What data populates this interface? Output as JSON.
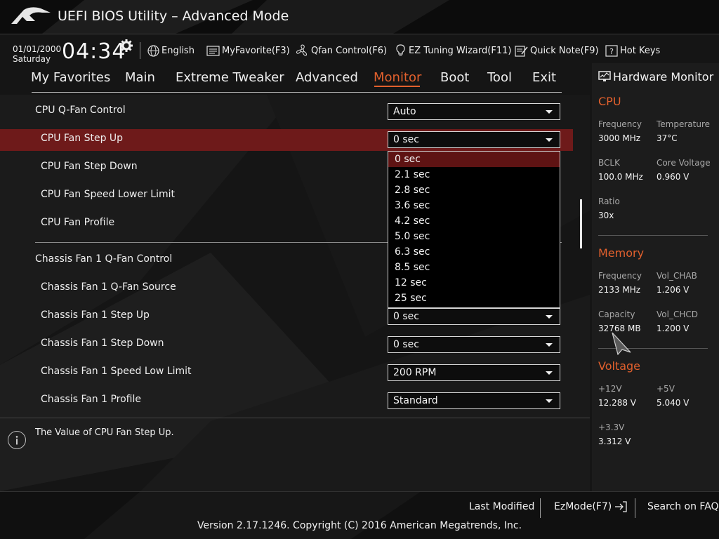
{
  "window": {
    "title": "UEFI BIOS Utility – Advanced Mode"
  },
  "infobar": {
    "date": "01/01/2000",
    "day": "Saturday",
    "time": "04:34",
    "tools": [
      {
        "label": "English",
        "icon": "globe-icon"
      },
      {
        "label": "MyFavorite(F3)",
        "icon": "favorite-icon"
      },
      {
        "label": "Qfan Control(F6)",
        "icon": "fan-icon"
      },
      {
        "label": "EZ Tuning Wizard(F11)",
        "icon": "lightbulb-icon"
      },
      {
        "label": "Quick Note(F9)",
        "icon": "note-icon"
      },
      {
        "label": "Hot Keys",
        "icon": "hotkeys-icon"
      }
    ]
  },
  "nav": {
    "tabs": [
      "My Favorites",
      "Main",
      "Extreme Tweaker",
      "Advanced",
      "Monitor",
      "Boot",
      "Tool",
      "Exit"
    ],
    "active": "Monitor"
  },
  "settings": [
    {
      "label": "CPU Q-Fan Control",
      "value": "Auto"
    },
    {
      "label": "CPU Fan Step Up",
      "value": "0 sec"
    },
    {
      "label": "CPU Fan Step Down",
      "value": ""
    },
    {
      "label": "CPU Fan Speed Lower Limit",
      "value": ""
    },
    {
      "label": "CPU Fan Profile",
      "value": ""
    },
    {
      "label": "Chassis Fan 1 Q-Fan Control",
      "value": ""
    },
    {
      "label": "Chassis Fan 1 Q-Fan Source",
      "value": ""
    },
    {
      "label": "Chassis Fan 1 Step Up",
      "value": "0 sec"
    },
    {
      "label": "Chassis Fan 1 Step Down",
      "value": "0 sec"
    },
    {
      "label": "Chassis Fan 1 Speed Low Limit",
      "value": "200 RPM"
    },
    {
      "label": "Chassis Fan 1 Profile",
      "value": "Standard"
    }
  ],
  "dropdown": {
    "options": [
      "0 sec",
      "2.1 sec",
      "2.8 sec",
      "3.6 sec",
      "4.2 sec",
      "5.0 sec",
      "6.3 sec",
      "8.5 sec",
      "12 sec",
      "25 sec"
    ],
    "selected": "0 sec"
  },
  "help": {
    "text": "The Value of CPU Fan Step Up."
  },
  "hardware_monitor": {
    "title": "Hardware Monitor",
    "cpu": {
      "heading": "CPU",
      "frequency_label": "Frequency",
      "frequency": "3000 MHz",
      "temperature_label": "Temperature",
      "temperature": "37°C",
      "bclk_label": "BCLK",
      "bclk": "100.0 MHz",
      "core_voltage_label": "Core Voltage",
      "core_voltage": "0.960 V",
      "ratio_label": "Ratio",
      "ratio": "30x"
    },
    "memory": {
      "heading": "Memory",
      "frequency_label": "Frequency",
      "frequency": "2133 MHz",
      "vol_chab_label": "Vol_CHAB",
      "vol_chab": "1.206 V",
      "capacity_label": "Capacity",
      "capacity": "32768 MB",
      "vol_chcd_label": "Vol_CHCD",
      "vol_chcd": "1.200 V"
    },
    "voltage": {
      "heading": "Voltage",
      "v12_label": "+12V",
      "v12": "12.288 V",
      "v5_label": "+5V",
      "v5": "5.040 V",
      "v33_label": "+3.3V",
      "v33": "3.312 V"
    }
  },
  "bottom": {
    "last_modified": "Last Modified",
    "ezmode": "EzMode(F7)",
    "search_faq": "Search on FAQ",
    "copyright": "Version 2.17.1246. Copyright (C) 2016 American Megatrends, Inc."
  },
  "colors": {
    "accent": "#e2602d",
    "highlight": "#6e1a1a",
    "background": "#151515"
  }
}
